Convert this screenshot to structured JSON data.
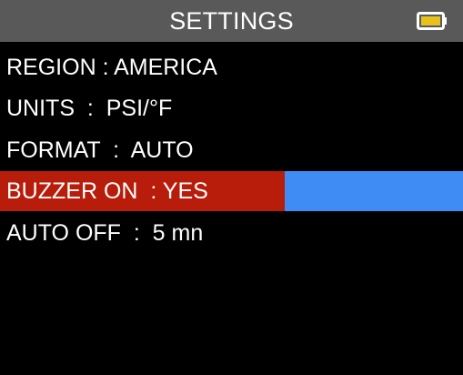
{
  "header": {
    "title": "SETTINGS",
    "battery_icon": "battery-full-icon"
  },
  "menu": {
    "items": [
      {
        "label": "REGION : AMERICA"
      },
      {
        "label": "UNITS  :  PSI/°F"
      },
      {
        "label": "FORMAT  :  AUTO"
      },
      {
        "label": "BUZZER ON  : YES",
        "selected": true
      },
      {
        "label": "AUTO OFF  :  5 mn"
      }
    ]
  },
  "colors": {
    "header_bg": "#595959",
    "selected_bg": "#b81c0a",
    "selected_accent": "#3f8cf5",
    "background": "#000000",
    "text": "#ffffff"
  }
}
